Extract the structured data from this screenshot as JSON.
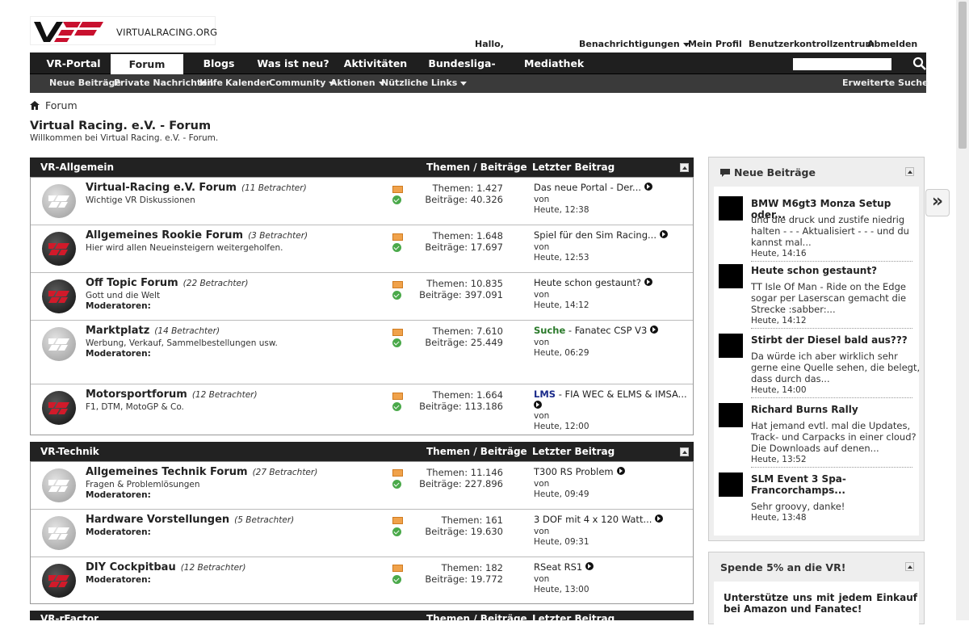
{
  "header": {
    "logo_text": "VIRTUALRACING.ORG",
    "greeting": "Hallo,",
    "links": [
      "Benachrichtigungen",
      "Mein Profil",
      "Benutzerkontrollzentrum",
      "Abmelden"
    ]
  },
  "nav": {
    "tabs": [
      "VR-Portal",
      "Forum",
      "Blogs",
      "Was ist neu?",
      "Aktivitäten",
      "Bundesliga-Tippspiel",
      "Mediathek"
    ],
    "active_tab": "Forum",
    "subnav": [
      "Neue Beiträge",
      "Private Nachrichten",
      "Hilfe",
      "Kalender",
      "Community",
      "Aktionen",
      "Nützliche Links"
    ],
    "advanced_search": "Erweiterte Suche"
  },
  "breadcrumb": "Forum",
  "page": {
    "title": "Virtual Racing. e.V. - Forum",
    "subtitle": "Willkommen bei Virtual Racing. e.V. - Forum."
  },
  "categories": [
    {
      "title": "VR-Allgemein",
      "col_stats": "Themen / Beiträge",
      "col_last": "Letzter Beitrag",
      "forums": [
        {
          "name": "Virtual-Racing e.V. Forum",
          "viewers": "(11 Betrachter)",
          "desc": "Wichtige VR Diskussionen",
          "mods": "",
          "topics": "Themen: 1.427",
          "posts": "Beiträge: 40.326",
          "lp_prefix": "",
          "lp_title": "Das neue Portal - Der...",
          "lp_by": "von",
          "lp_time": "Heute, 12:38"
        },
        {
          "name": "Allgemeines Rookie Forum",
          "viewers": "(3 Betrachter)",
          "desc": "Hier wird allen Neueinsteigern weitergeholfen.",
          "mods": "",
          "topics": "Themen: 1.648",
          "posts": "Beiträge: 17.697",
          "lp_prefix": "",
          "lp_title": "Spiel für den Sim Racing...",
          "lp_by": "von",
          "lp_time": "Heute, 12:53"
        },
        {
          "name": "Off Topic Forum",
          "viewers": "(22 Betrachter)",
          "desc": "Gott und die Welt",
          "mods": "Moderatoren:",
          "topics": "Themen: 10.835",
          "posts": "Beiträge: 397.091",
          "lp_prefix": "",
          "lp_title": "Heute schon gestaunt?",
          "lp_by": "von",
          "lp_time": "Heute, 14:12"
        },
        {
          "name": "Marktplatz",
          "viewers": "(14 Betrachter)",
          "desc": "Werbung, Verkauf, Sammelbestellungen usw.",
          "mods": "Moderatoren:",
          "topics": "Themen: 7.610",
          "posts": "Beiträge: 25.449",
          "lp_prefix": "Suche",
          "lp_title": " - Fanatec CSP V3",
          "lp_by": "von",
          "lp_time": "Heute, 06:29"
        },
        {
          "name": "Motorsportforum",
          "viewers": "(12 Betrachter)",
          "desc": "F1, DTM, MotoGP & Co.",
          "mods": "",
          "topics": "Themen: 1.664",
          "posts": "Beiträge: 113.186",
          "lp_prefix": "LMS",
          "lp_title": " - FIA WEC & ELMS & IMSA...",
          "lp_by": "von",
          "lp_time": "Heute, 12:00"
        }
      ]
    },
    {
      "title": "VR-Technik",
      "col_stats": "Themen / Beiträge",
      "col_last": "Letzter Beitrag",
      "forums": [
        {
          "name": "Allgemeines Technik Forum",
          "viewers": "(27 Betrachter)",
          "desc": "Fragen & Problemlösungen",
          "mods": "Moderatoren:",
          "topics": "Themen: 11.146",
          "posts": "Beiträge: 227.896",
          "lp_prefix": "",
          "lp_title": "T300 RS Problem",
          "lp_by": "von",
          "lp_time": "Heute, 09:49"
        },
        {
          "name": "Hardware Vorstellungen",
          "viewers": "(5 Betrachter)",
          "desc": "",
          "mods": "Moderatoren:",
          "topics": "Themen: 161",
          "posts": "Beiträge: 19.630",
          "lp_prefix": "",
          "lp_title": "3 DOF mit 4 x 120 Watt...",
          "lp_by": "von",
          "lp_time": "Heute, 09:31"
        },
        {
          "name": "DIY Cockpitbau",
          "viewers": "(12 Betrachter)",
          "desc": "",
          "mods": "Moderatoren:",
          "topics": "Themen: 182",
          "posts": "Beiträge: 19.772",
          "lp_prefix": "",
          "lp_title": "RSeat RS1",
          "lp_by": "von",
          "lp_time": "Heute, 13:00"
        }
      ]
    },
    {
      "title": "VR-rFactor",
      "col_stats": "Themen / Beiträge",
      "col_last": "Letzter Beitrag",
      "forums": []
    }
  ],
  "sidebar": {
    "new_posts_title": "Neue Beiträge",
    "posts": [
      {
        "title": "BMW M6gt3 Monza Setup oder...",
        "text": "und die druck und zustife niedrig halten - - - Aktualisiert - - - und du kannst mal...",
        "time": "Heute, 14:16"
      },
      {
        "title": "Heute schon gestaunt?",
        "text": "TT Isle Of Man - Ride on the Edge sogar per Laserscan gemacht die Strecke :sabber:...",
        "time": "Heute, 14:12"
      },
      {
        "title": "Stirbt der Diesel bald aus???",
        "text": "Da würde ich aber wirklich sehr gerne eine Quelle sehen, die belegt, dass durch das...",
        "time": "Heute, 14:00"
      },
      {
        "title": "Richard Burns Rally",
        "text": "Hat jemand evtl. mal die Updates, Track- und Carpacks in einer cloud? Die Downloads auf denen...",
        "time": "Heute, 13:52"
      },
      {
        "title": "SLM Event 3 Spa-Francorchamps...",
        "text": "Sehr groovy, danke!",
        "time": "Heute, 13:48"
      }
    ],
    "donate_title": "Spende 5% an die VR!",
    "donate_text": "Unterstütze uns mit jedem Einkauf bei Amazon und Fanatec!"
  }
}
